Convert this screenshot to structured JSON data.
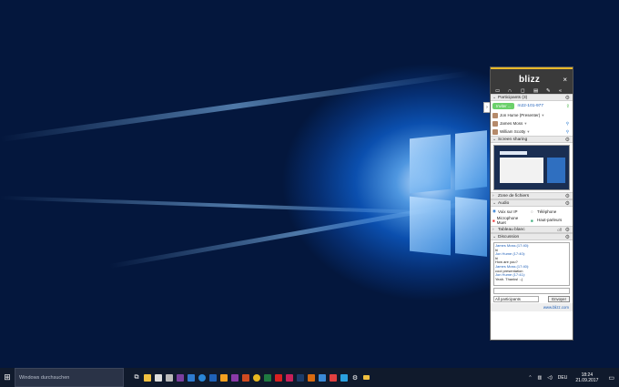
{
  "panel": {
    "logo": "blizz",
    "close": "×",
    "toolbar_icons": [
      "video-icon",
      "headset-icon",
      "chat-icon",
      "files-icon",
      "pen-icon",
      "collapse-icon"
    ],
    "participants": {
      "title": "Participants (3)",
      "join_button": "Inviter ...",
      "session_id": "m22-101-977",
      "people": [
        "Jon Hume (Presenter)",
        "James Moss",
        "William Scotty"
      ]
    },
    "screen_sharing": {
      "title": "Screen sharing"
    },
    "files": {
      "title": "Zone de fichiers"
    },
    "audio": {
      "title": "Audio",
      "voip": "Voix sur IP",
      "phone": "Téléphone",
      "mic": "Microphone Muet",
      "speakers": "Haut-parleurs"
    },
    "whiteboard": {
      "title": "Tableau blanc",
      "state": "off"
    },
    "discussion": {
      "title": "Discussion",
      "messages": [
        {
          "from": "James Moss (17:40):",
          "text": "hi"
        },
        {
          "from": "Jon Hume (17:40):",
          "text": "hi"
        },
        {
          "from": "",
          "text": "How are you?"
        },
        {
          "from": "James Moss (17:40):",
          "text": "cool presentation"
        },
        {
          "from": "Jon Hume (17:41):",
          "text": "Yeah. Thanks! :-)"
        }
      ],
      "recipients": "All participants",
      "send": "Envoyer"
    },
    "link": "www.blizz.com"
  },
  "taskbar": {
    "search_placeholder": "Windows durchsuchen",
    "time": "18:24",
    "date": "21.09.2017",
    "lang": "DEU"
  }
}
